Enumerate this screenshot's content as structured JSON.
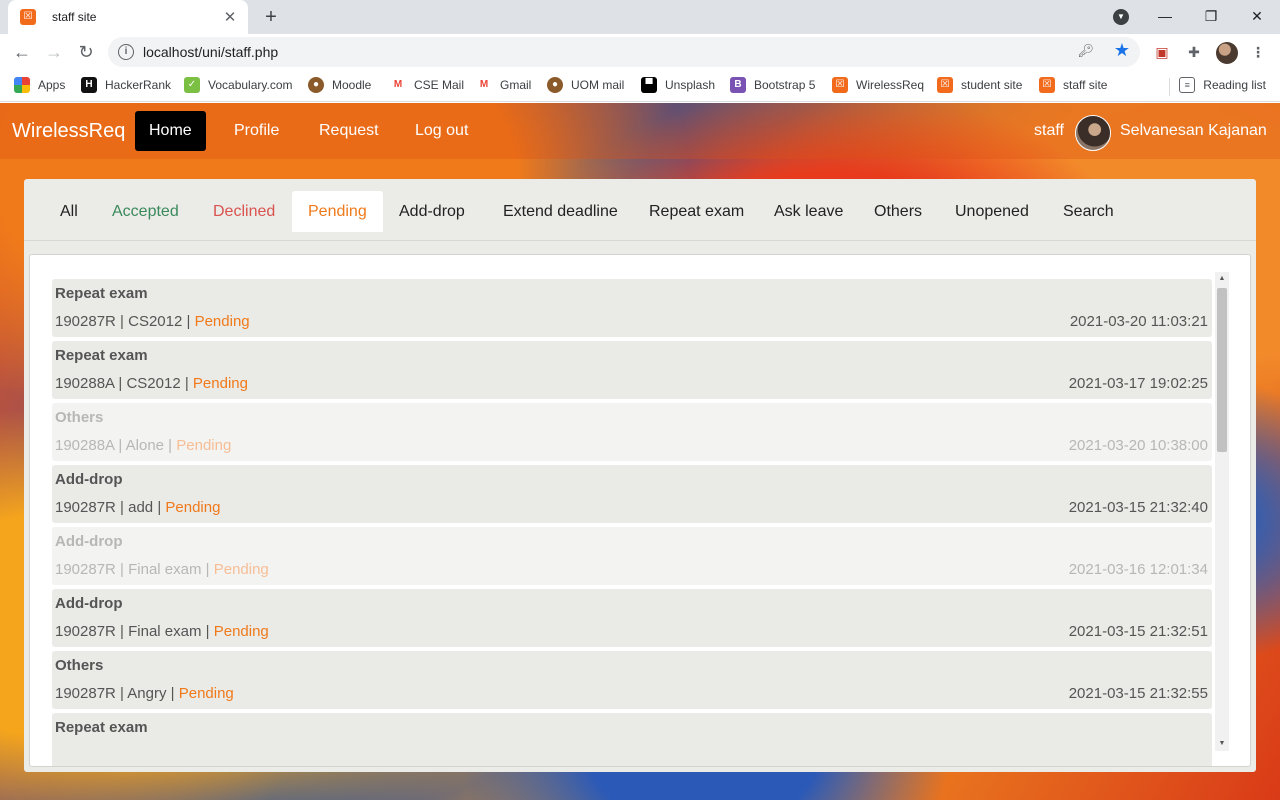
{
  "browser": {
    "tab_title": "staff site",
    "tab_close": "✕",
    "new_tab": "+",
    "url": "localhost/uni/staff.php",
    "back": "←",
    "forward": "→",
    "reload": "↻",
    "minimize": "—",
    "restore": "❐",
    "close": "✕"
  },
  "bookmarks": {
    "items": [
      {
        "label": "Apps",
        "icon": "apps-grid-icon"
      },
      {
        "label": "HackerRank",
        "icon": "hackerrank-icon"
      },
      {
        "label": "Vocabulary.com",
        "icon": "vocabulary-icon"
      },
      {
        "label": "Moodle",
        "icon": "moodle-icon"
      },
      {
        "label": "CSE Mail",
        "icon": "gmail-icon"
      },
      {
        "label": "Gmail",
        "icon": "gmail-icon"
      },
      {
        "label": "UOM mail",
        "icon": "moodle-icon"
      },
      {
        "label": "Unsplash",
        "icon": "unsplash-icon"
      },
      {
        "label": "Bootstrap 5",
        "icon": "bootstrap-icon"
      },
      {
        "label": "WirelessReq",
        "icon": "xampp-icon"
      },
      {
        "label": "student site",
        "icon": "xampp-icon"
      },
      {
        "label": "staff site",
        "icon": "xampp-icon"
      }
    ],
    "reading_list": "Reading list"
  },
  "site_nav": {
    "brand": "WirelessReq",
    "links": [
      "Home",
      "Profile",
      "Request",
      "Log out"
    ],
    "active": "Home",
    "role": "staff",
    "user_name": "Selvanesan Kajanan"
  },
  "filter_tabs": [
    "All",
    "Accepted",
    "Declined",
    "Pending",
    "Add-drop",
    "Extend deadline",
    "Repeat exam",
    "Ask leave",
    "Others",
    "Unopened",
    "Search"
  ],
  "active_filter": "Pending",
  "requests": [
    {
      "type": "Repeat exam",
      "index": "190287R",
      "subject": "CS2012",
      "status": "Pending",
      "date": "2021-03-20 11:03:21",
      "opened": true
    },
    {
      "type": "Repeat exam",
      "index": "190288A",
      "subject": "CS2012",
      "status": "Pending",
      "date": "2021-03-17 19:02:25",
      "opened": true
    },
    {
      "type": "Others",
      "index": "190288A",
      "subject": "Alone",
      "status": "Pending",
      "date": "2021-03-20 10:38:00",
      "opened": false
    },
    {
      "type": "Add-drop",
      "index": "190287R",
      "subject": "add",
      "status": "Pending",
      "date": "2021-03-15 21:32:40",
      "opened": true
    },
    {
      "type": "Add-drop",
      "index": "190287R",
      "subject": "Final exam",
      "status": "Pending",
      "date": "2021-03-16 12:01:34",
      "opened": false
    },
    {
      "type": "Add-drop",
      "index": "190287R",
      "subject": "Final exam",
      "status": "Pending",
      "date": "2021-03-15 21:32:51",
      "opened": true
    },
    {
      "type": "Others",
      "index": "190287R",
      "subject": "Angry",
      "status": "Pending",
      "date": "2021-03-15 21:32:55",
      "opened": true
    },
    {
      "type": "Repeat exam",
      "index": "",
      "subject": "",
      "status": "",
      "date": "",
      "opened": true
    }
  ],
  "colors": {
    "accepted": "#3a8a5c",
    "declined": "#d9534f",
    "pending": "#f07a1a",
    "panel_bg": "#ebebe8",
    "nav_active_bg": "#000000"
  }
}
